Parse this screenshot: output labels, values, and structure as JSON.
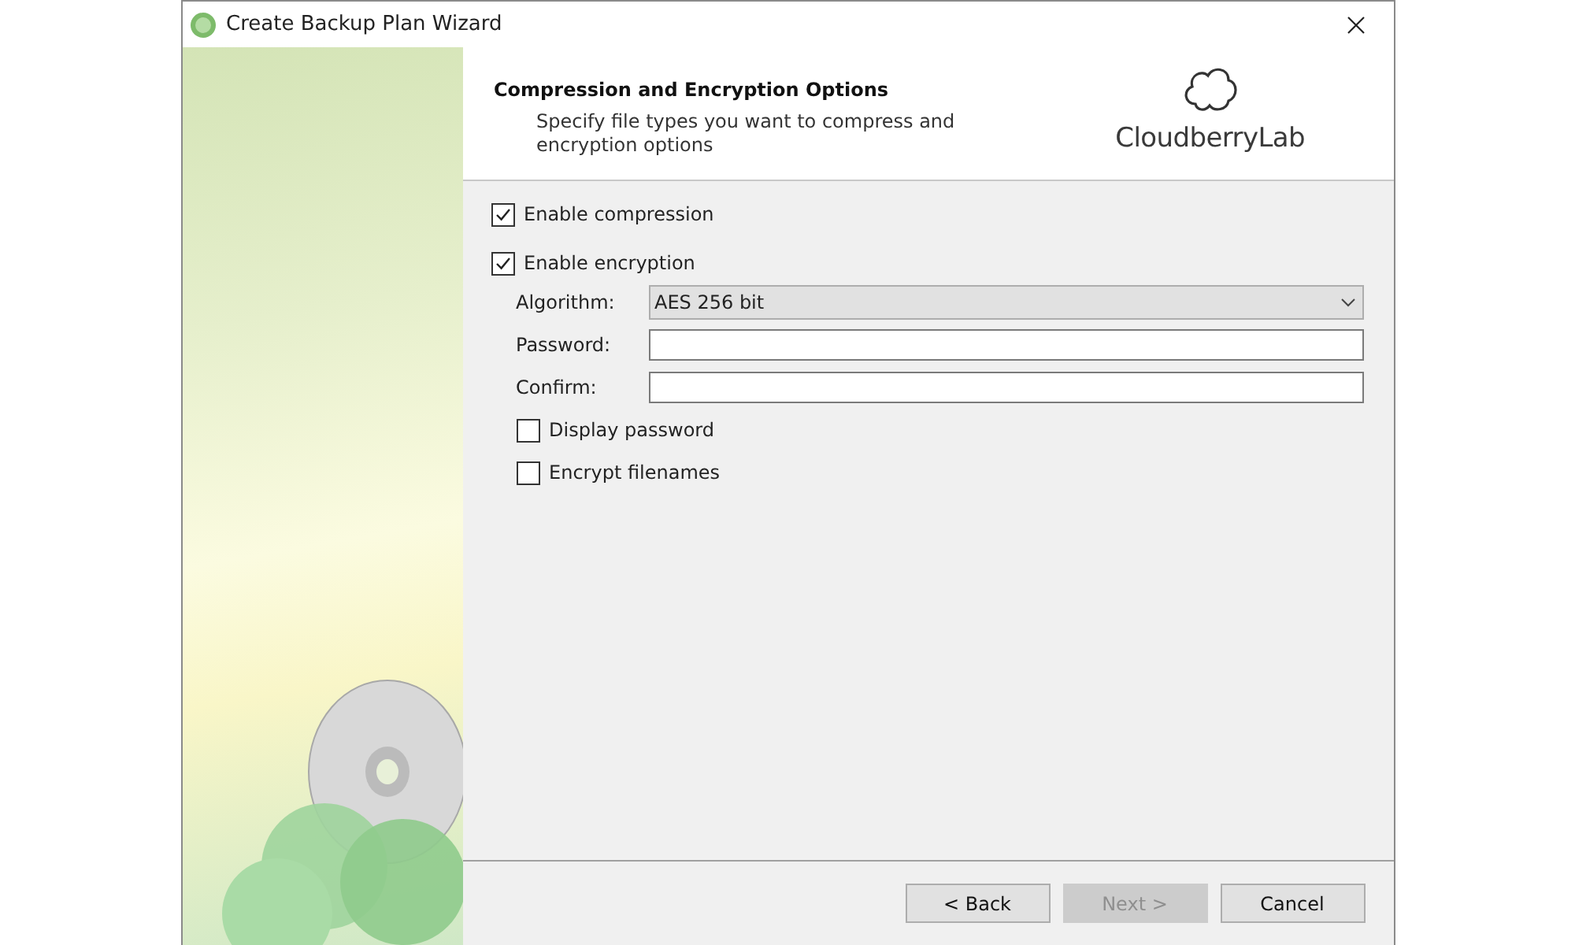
{
  "window": {
    "title": "Create Backup Plan Wizard"
  },
  "header": {
    "title": "Compression and Encryption Options",
    "subtitle": "Specify file types you want to compress and encryption options",
    "logo_text": "CloudberryLab"
  },
  "compression": {
    "label": "Enable compression",
    "checked": true
  },
  "encryption": {
    "label": "Enable encryption",
    "checked": true
  },
  "fields": [
    {
      "kind": "select",
      "label": "Algorithm:",
      "value": "AES 256 bit"
    },
    {
      "kind": "text",
      "label": "Password:"
    },
    {
      "kind": "text",
      "label": "Confirm:"
    }
  ],
  "sub_options": [
    {
      "label": "Display password",
      "checked": false
    },
    {
      "label": "Encrypt filenames",
      "checked": false
    }
  ],
  "buttons": [
    {
      "label": "< Back",
      "disabled": false
    },
    {
      "label": "Next >",
      "disabled": true
    },
    {
      "label": "Cancel",
      "disabled": false
    }
  ]
}
